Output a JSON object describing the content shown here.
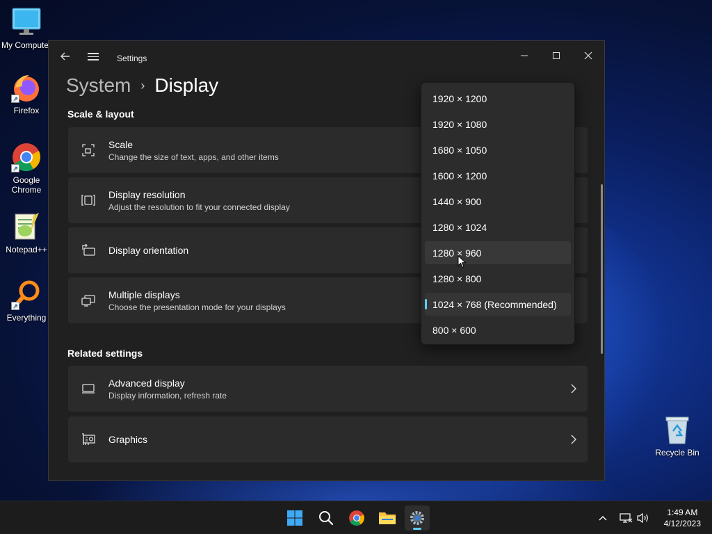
{
  "desktop": {
    "icons": [
      {
        "label": "My Computer"
      },
      {
        "label": "Firefox"
      },
      {
        "label": "Google Chrome"
      },
      {
        "label": "Notepad++"
      },
      {
        "label": "Everything"
      },
      {
        "label": "Recycle Bin"
      }
    ]
  },
  "window": {
    "title": "Settings",
    "breadcrumb": {
      "parent": "System",
      "current": "Display"
    },
    "sections": {
      "scale_layout": "Scale & layout",
      "related": "Related settings"
    },
    "cards": [
      {
        "title": "Scale",
        "subtitle": "Change the size of text, apps, and other items",
        "icon": "scale-icon"
      },
      {
        "title": "Display resolution",
        "subtitle": "Adjust the resolution to fit your connected display",
        "icon": "resolution-icon"
      },
      {
        "title": "Display orientation",
        "subtitle": "",
        "icon": "orientation-icon"
      },
      {
        "title": "Multiple displays",
        "subtitle": "Choose the presentation mode for your displays",
        "icon": "multiple-displays-icon"
      },
      {
        "title": "Advanced display",
        "subtitle": "Display information, refresh rate",
        "icon": "monitor-icon"
      },
      {
        "title": "Graphics",
        "subtitle": "",
        "icon": "graphics-card-icon"
      }
    ]
  },
  "resolution_dropdown": {
    "options": [
      "1920 × 1200",
      "1920 × 1080",
      "1680 × 1050",
      "1600 × 1200",
      "1440 × 900",
      "1280 × 1024",
      "1280 × 960",
      "1280 × 800",
      "1024 × 768 (Recommended)",
      "800 × 600"
    ],
    "selected": "1024 × 768 (Recommended)",
    "hovered": "1280 × 960"
  },
  "taskbar": {
    "apps": [
      "start-icon",
      "search-icon",
      "chrome-icon",
      "file-explorer-icon",
      "settings-icon"
    ],
    "clock": {
      "time": "1:49 AM",
      "date": "4/12/2023"
    }
  },
  "colors": {
    "accent": "#60cdff",
    "window_bg": "#202020",
    "card_bg": "#2b2b2b"
  }
}
